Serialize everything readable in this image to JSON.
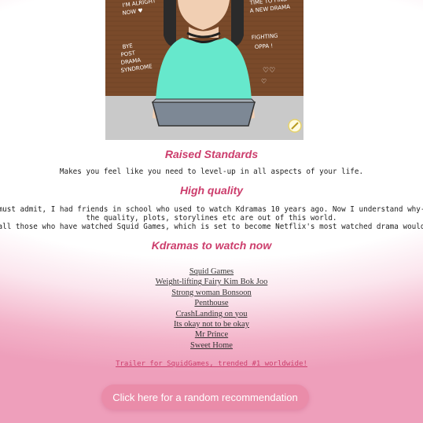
{
  "illustration": {
    "notes": {
      "left_top": "I'm alright now",
      "right_top": "Time to find a new drama",
      "left_bottom": "Bye post drama syndrome",
      "right_bottom": "Fighting oppa!"
    }
  },
  "sections": {
    "raised": {
      "title": "Raised Standards",
      "text": "Makes you feel like you need to level-up in all aspects of your life."
    },
    "quality": {
      "title": "High quality",
      "line1": "must admit, I had friends in school who used to watch Kdramas 10 years ago. Now I understand why-",
      "line2": "the quality, plots, storylines etc are out of this world.",
      "line3": "all those who have watched Squid Games, which is set to become Netflix's most watched drama would"
    },
    "watch": {
      "title": "Kdramas to watch now",
      "links": [
        "Squid Games",
        "Weight-lifting Fairy Kim Bok Joo",
        "Strong woman Bonsoon",
        "Penthouse",
        "CrashLanding on you",
        "Its okay not to be okay",
        "Mr Prince",
        "Sweet Home"
      ]
    }
  },
  "trailer_link": "Trailer for SquidGames, trended #1 worldwide!",
  "random_button": "Click here for a random recommendation",
  "colors": {
    "accent": "#cc3d6c",
    "button": "#ea8ca9"
  }
}
